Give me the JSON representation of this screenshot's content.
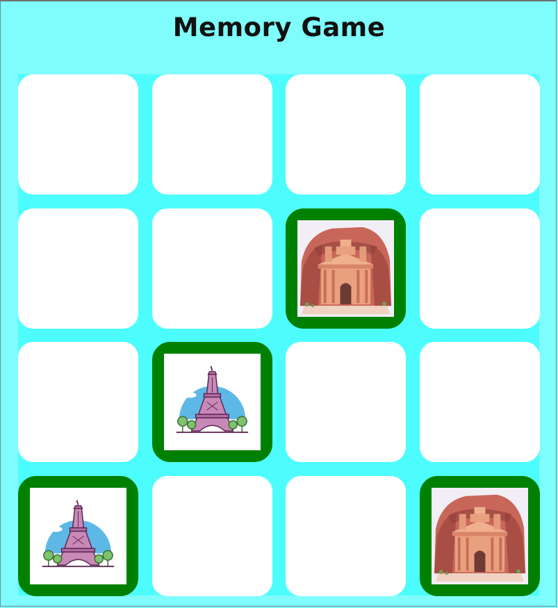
{
  "title": "Memory Game",
  "colors": {
    "background": "#7ffcfc",
    "board": "#4dfdfd",
    "card_back": "#ffffff",
    "matched_border": "#008000"
  },
  "grid": {
    "rows": 4,
    "cols": 4
  },
  "cards": [
    {
      "state": "hidden"
    },
    {
      "state": "hidden"
    },
    {
      "state": "hidden"
    },
    {
      "state": "hidden"
    },
    {
      "state": "hidden"
    },
    {
      "state": "hidden"
    },
    {
      "state": "matched",
      "image": "petra-treasury-icon"
    },
    {
      "state": "hidden"
    },
    {
      "state": "hidden"
    },
    {
      "state": "matched",
      "image": "eiffel-tower-icon"
    },
    {
      "state": "hidden"
    },
    {
      "state": "hidden"
    },
    {
      "state": "matched",
      "image": "eiffel-tower-icon"
    },
    {
      "state": "hidden"
    },
    {
      "state": "hidden"
    },
    {
      "state": "matched",
      "image": "petra-treasury-icon"
    }
  ]
}
